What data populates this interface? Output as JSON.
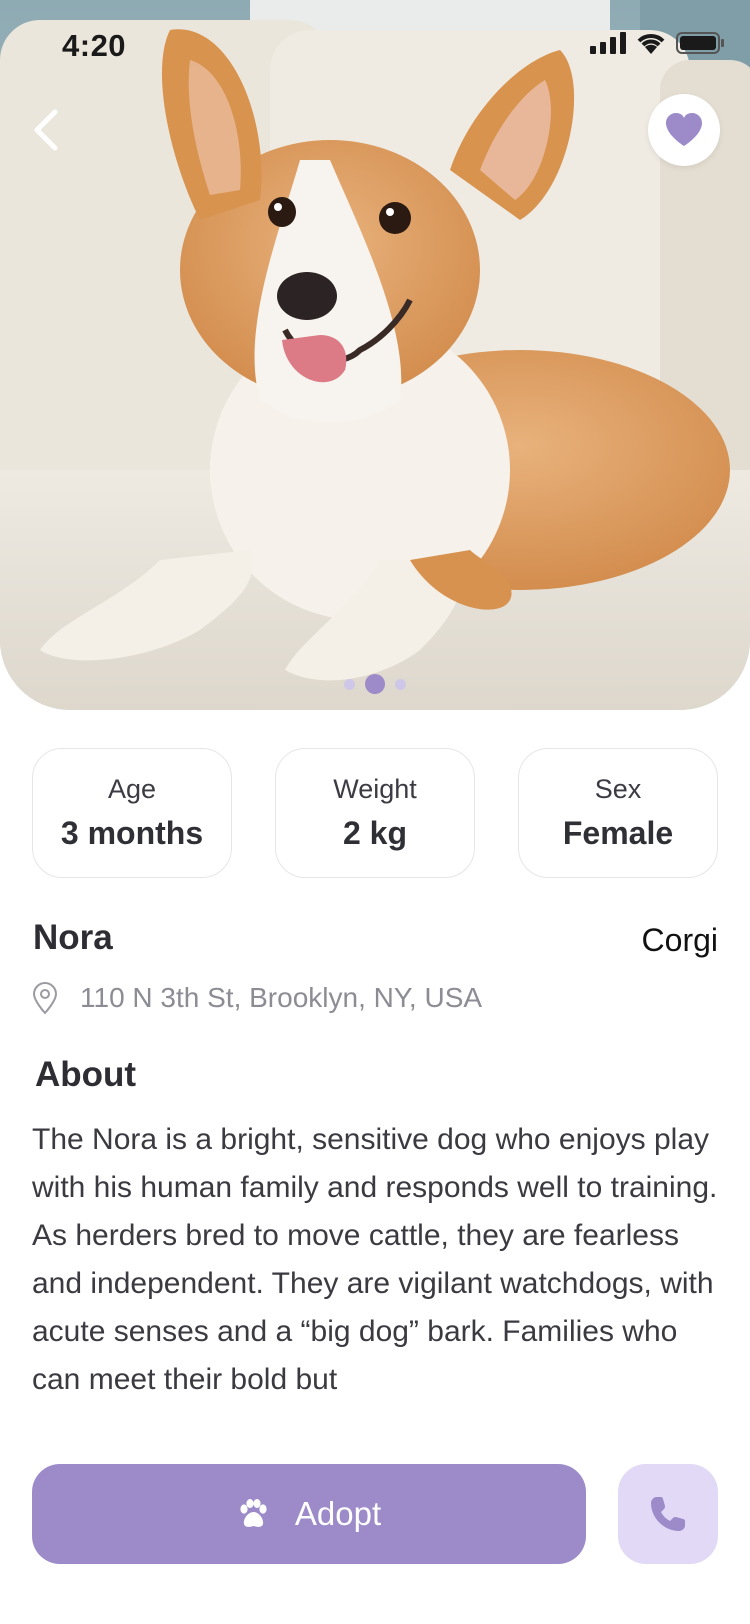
{
  "status_bar": {
    "time": "4:20"
  },
  "hero": {
    "image_subject": "corgi-on-couch",
    "carousel_total": 3,
    "carousel_active": 2
  },
  "stats": [
    {
      "label": "Age",
      "value": "3 months"
    },
    {
      "label": "Weight",
      "value": "2 kg"
    },
    {
      "label": "Sex",
      "value": "Female"
    }
  ],
  "pet": {
    "name": "Nora",
    "breed": "Corgi",
    "location": "110 N 3th St, Brooklyn, NY, USA"
  },
  "about": {
    "title": "About",
    "text": "The Nora is a bright, sensitive dog who enjoys play with his human family and responds well to training. As herders bred to move cattle, they are fearless and independent. They are vigilant watchdogs, with acute senses and a “big dog” bark. Families who can meet their bold but"
  },
  "actions": {
    "adopt_label": "Adopt",
    "adopt_icon": "paw-icon",
    "call_icon": "phone-icon"
  },
  "colors": {
    "accent": "#9c8ac9",
    "accent_light": "#e1d9f6",
    "heart": "#9c8ac9"
  }
}
